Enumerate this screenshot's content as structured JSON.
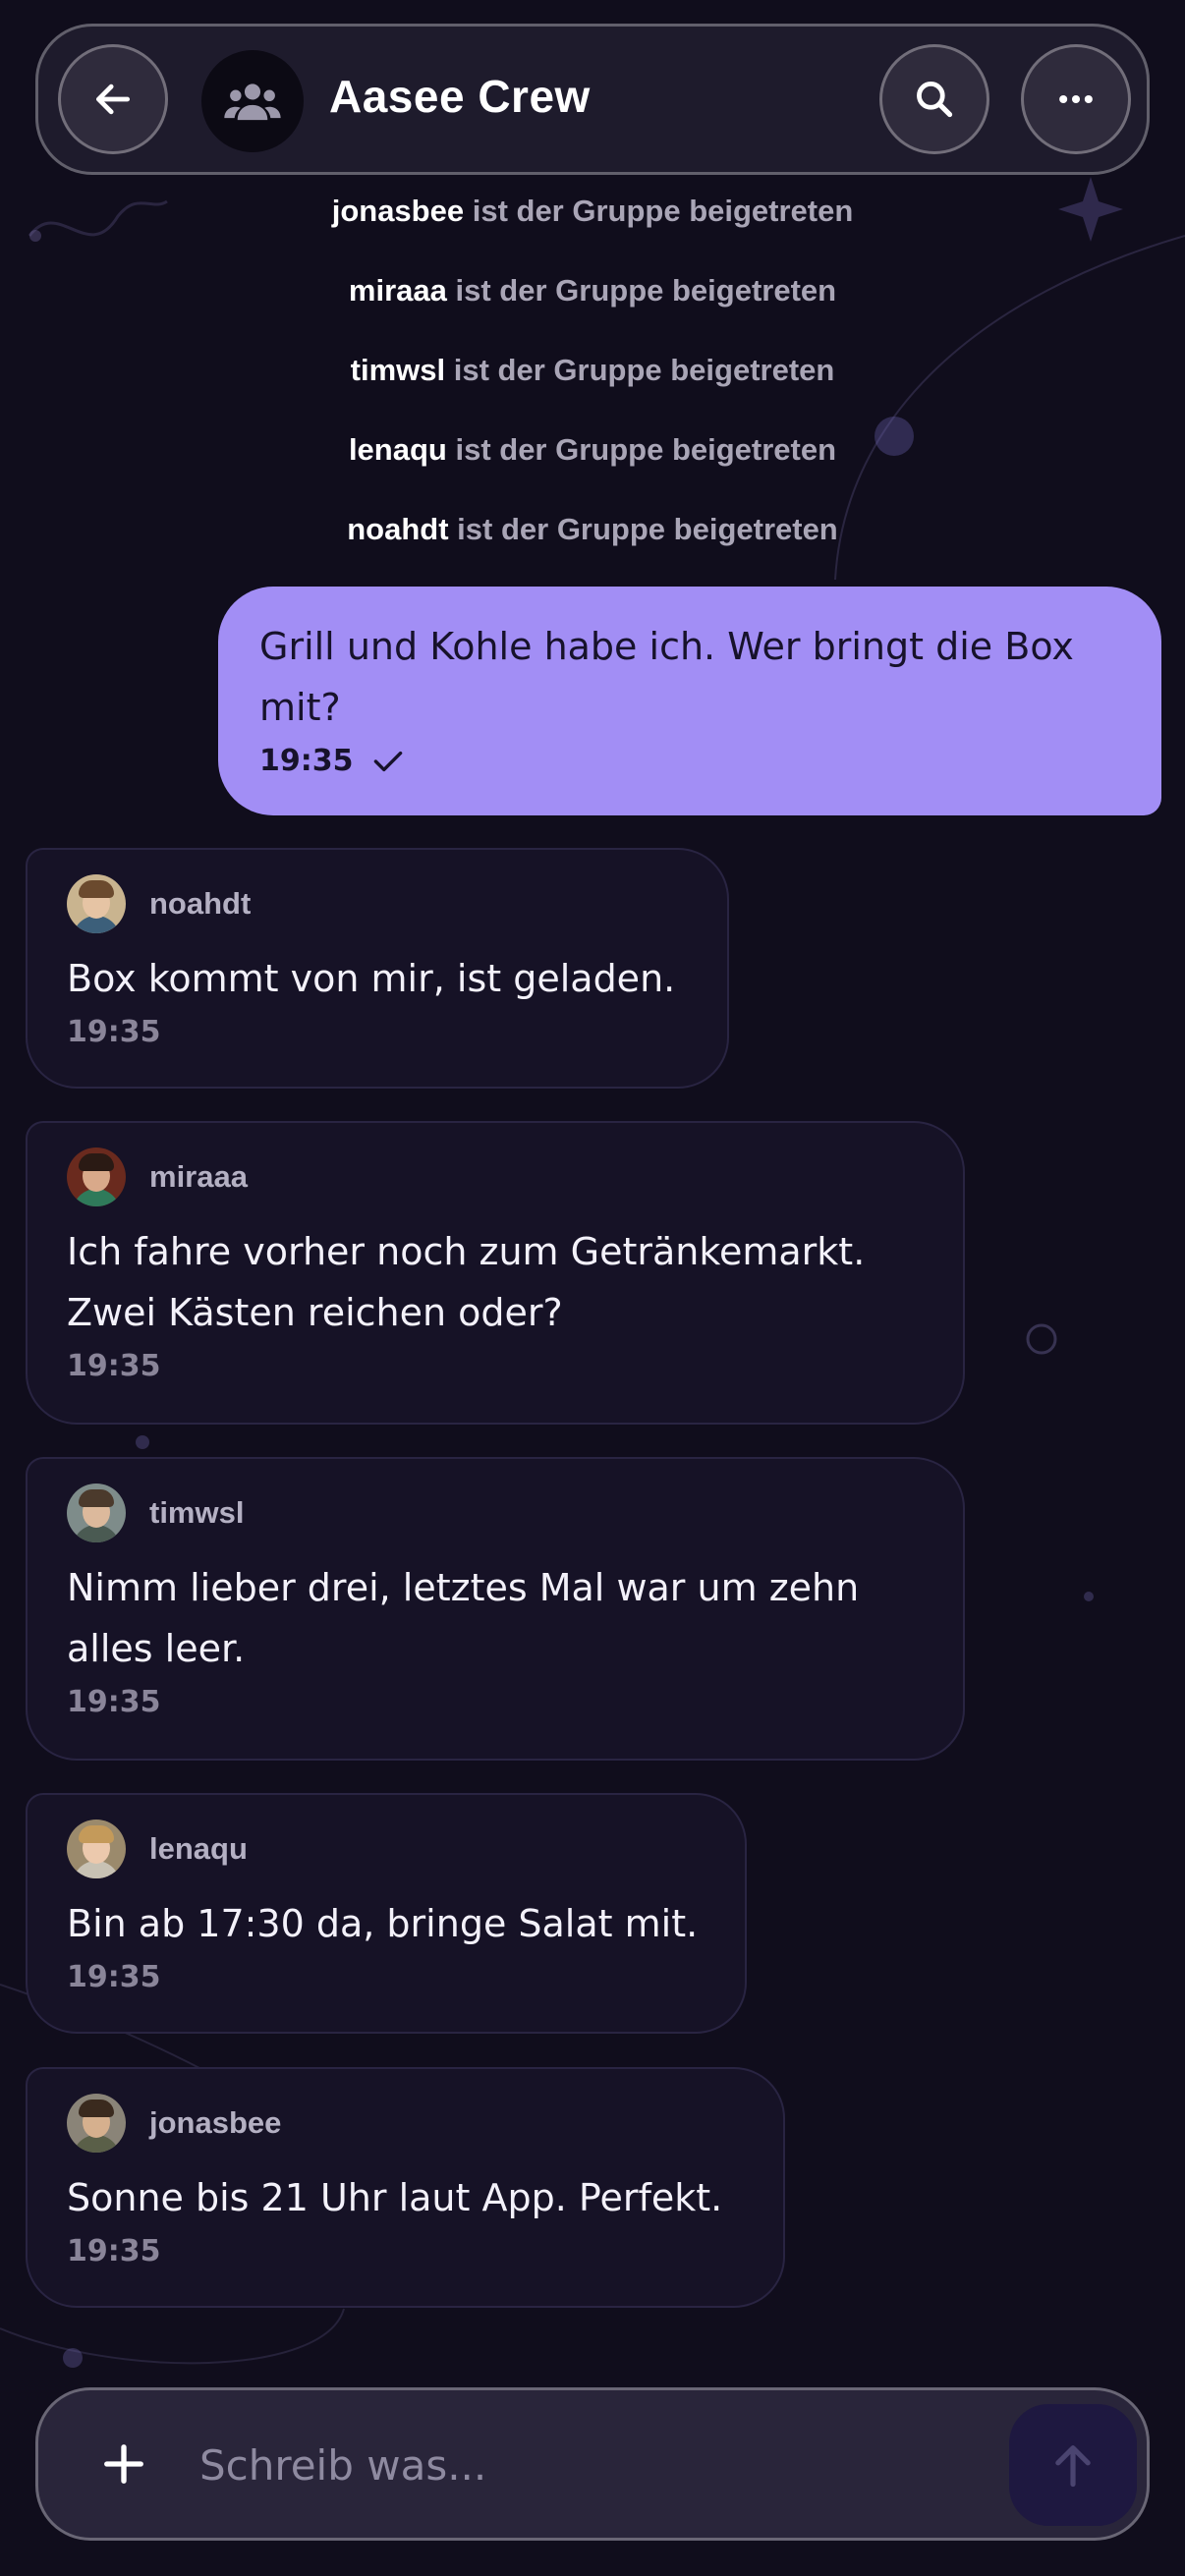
{
  "header": {
    "title": "Aasee Crew",
    "back_icon": "arrow-left-icon",
    "group_icon": "group-icon",
    "search_icon": "search-icon",
    "more_icon": "more-horizontal-icon"
  },
  "system_messages": [
    {
      "user": "jonasbee",
      "text": "ist der Gruppe beigetreten"
    },
    {
      "user": "miraaa",
      "text": "ist der Gruppe beigetreten"
    },
    {
      "user": "timwsl",
      "text": "ist der Gruppe beigetreten"
    },
    {
      "user": "lenaqu",
      "text": "ist der Gruppe beigetreten"
    },
    {
      "user": "noahdt",
      "text": "ist der Gruppe beigetreten"
    }
  ],
  "outgoing": {
    "text": "Grill und Kohle habe ich. Wer bringt die Box mit?",
    "time": "19:35",
    "status_icon": "check-icon"
  },
  "messages": [
    {
      "sender": "noahdt",
      "text": "Box kommt von mir, ist geladen.",
      "time": "19:35"
    },
    {
      "sender": "miraaa",
      "text": "Ich fahre vorher noch zum Getränkemarkt. Zwei Kästen reichen oder?",
      "time": "19:35"
    },
    {
      "sender": "timwsl",
      "text": "Nimm lieber drei, letztes Mal war um zehn alles leer.",
      "time": "19:35"
    },
    {
      "sender": "lenaqu",
      "text": "Bin ab 17:30 da, bringe Salat mit.",
      "time": "19:35"
    },
    {
      "sender": "jonasbee",
      "text": "Sonne bis 21 Uhr laut App. Perfekt.",
      "time": "19:35"
    }
  ],
  "composer": {
    "placeholder": "Schreib was...",
    "value": "",
    "add_icon": "plus-icon",
    "send_icon": "arrow-up-icon"
  },
  "colors": {
    "background": "#100d1c",
    "accent": "#a28ef5",
    "bubble_in": "#161226",
    "send_button": "#1e1840"
  }
}
